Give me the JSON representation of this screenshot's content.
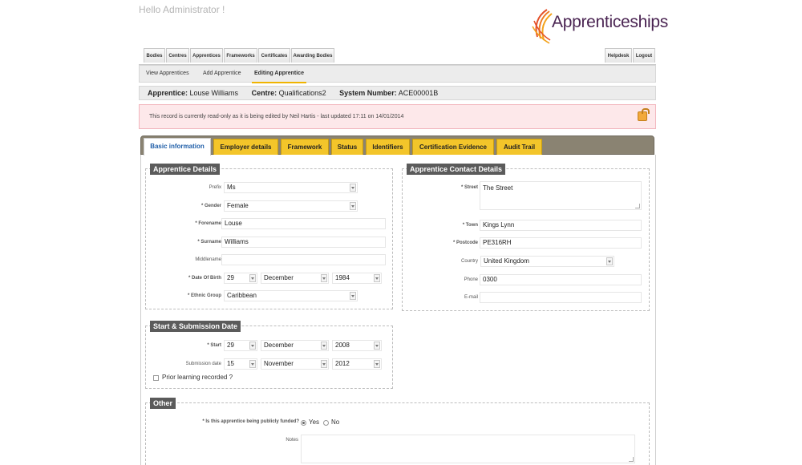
{
  "greeting": "Hello Administrator !",
  "logo": {
    "text": "Apprenticeships"
  },
  "top_tabs": [
    "Bodies",
    "Centres",
    "Apprentices",
    "Frameworks",
    "Certificates",
    "Awarding Bodies"
  ],
  "right_tabs": [
    "Helpdesk",
    "Logout"
  ],
  "sub_nav": [
    "View Apprentices",
    "Add Apprentice",
    "Editing Apprentice"
  ],
  "record": {
    "apprentice_label": "Apprentice:",
    "apprentice_value": "Louse Williams",
    "centre_label": "Centre:",
    "centre_value": "Qualifications2",
    "system_label": "System Number:",
    "system_value": "ACE00001B"
  },
  "alert": "This record is currently read-only as it is being edited by Neil Hartis - last updated 17:11 on 14/01/2014",
  "content_tabs": [
    "Basic information",
    "Employer details",
    "Framework",
    "Status",
    "Identifiers",
    "Certification Evidence",
    "Audit Trail"
  ],
  "apprentice_details": {
    "legend": "Apprentice Details",
    "prefix_label": "Prefix",
    "prefix": "Ms",
    "gender_label": "* Gender",
    "gender": "Female",
    "forename_label": "* Forename",
    "forename": "Louse",
    "surname_label": "* Surname",
    "surname": "Williams",
    "middlename_label": "Middlename",
    "middlename": "",
    "dob_label": "* Date Of Birth",
    "dob_day": "29",
    "dob_month": "December",
    "dob_year": "1984",
    "ethnic_label": "* Ethnic Group",
    "ethnic": "Caribbean"
  },
  "contact_details": {
    "legend": "Apprentice Contact Details",
    "street_label": "* Street",
    "street": "The Street",
    "town_label": "* Town",
    "town": "Kings Lynn",
    "postcode_label": "* Postcode",
    "postcode": "PE316RH",
    "country_label": "Country",
    "country": "United Kingdom",
    "phone_label": "Phone",
    "phone": "0300",
    "email_label": "E-mail",
    "email": ""
  },
  "start_submission": {
    "legend": "Start & Submission Date",
    "start_label": "* Start",
    "start_day": "29",
    "start_month": "December",
    "start_year": "2008",
    "sub_label": "Submission date",
    "sub_day": "15",
    "sub_month": "November",
    "sub_year": "2012",
    "prior_label": "Prior learning recorded ?"
  },
  "other": {
    "legend": "Other",
    "funded_label": "* Is this apprentice being publicly funded?",
    "yes": "Yes",
    "no": "No",
    "notes_label": "Notes"
  }
}
